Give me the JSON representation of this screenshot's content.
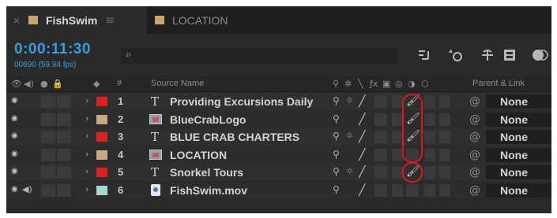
{
  "tabs": [
    {
      "label": "FishSwim",
      "swatch": "#c9a56b",
      "active": true
    },
    {
      "label": "LOCATION",
      "swatch": "#c9a56b",
      "active": false
    }
  ],
  "timecode": {
    "value": "0:00:11:30",
    "frames": "00690 (59.94 fps)"
  },
  "search": {
    "placeholder": ""
  },
  "toolbar_icons": [
    "comp-flowchart-icon",
    "draft-3d-icon",
    "shy-layers-icon",
    "frame-blending-icon",
    "motion-blur-icon"
  ],
  "header": {
    "source_name": "Source Name",
    "number": "#",
    "parent_link": "Parent & Link"
  },
  "layers": [
    {
      "num": "1",
      "name": "Providing Excursions Daily",
      "type": "text",
      "label_color": "#e02020",
      "brush": true
    },
    {
      "num": "2",
      "name": "BlueCrabLogo",
      "type": "image",
      "label_color": "#c9a883",
      "brush": true
    },
    {
      "num": "3",
      "name": "BLUE CRAB CHARTERS",
      "type": "text",
      "label_color": "#e02020",
      "brush": true
    },
    {
      "num": "4",
      "name": "LOCATION",
      "type": "image",
      "label_color": "#c9a883",
      "brush": false
    },
    {
      "num": "5",
      "name": "Snorkel Tours",
      "type": "text",
      "label_color": "#e02020",
      "brush": true
    },
    {
      "num": "6",
      "name": "FishSwim.mov",
      "type": "movie",
      "label_color": "#a6d8d0",
      "brush": false
    }
  ],
  "parent_value": "None",
  "colors": {
    "accent": "#3a9be0",
    "highlight_ring": "#e0141e"
  }
}
